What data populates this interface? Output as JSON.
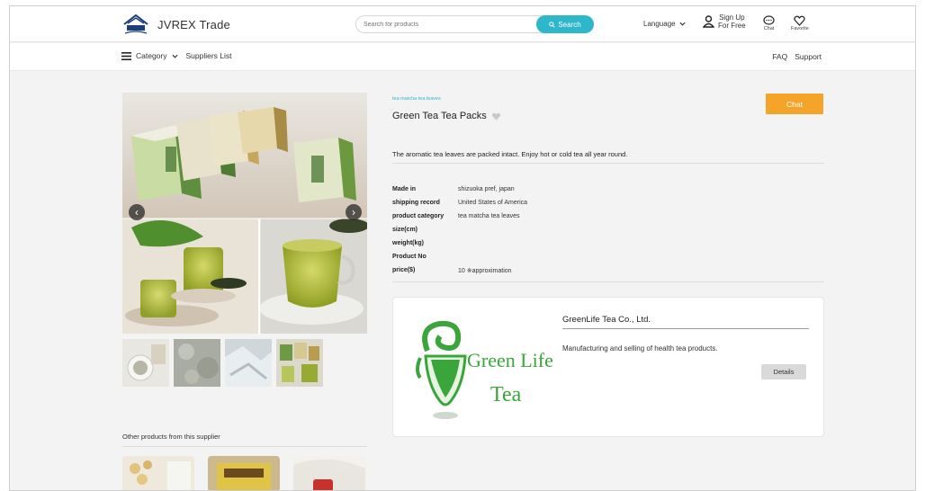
{
  "header": {
    "brand": "JVREX Trade",
    "search_placeholder": "Search for products",
    "search_button": "Search",
    "language": "Language",
    "signup_line1": "Sign Up",
    "signup_line2": "For Free",
    "chat": "Chat",
    "favorite": "Favorite"
  },
  "subnav": {
    "category": "Category",
    "suppliers": "Suppliers List",
    "faq": "FAQ",
    "support": "Support"
  },
  "product": {
    "breadcrumb": "tea matcha tea leaves",
    "title": "Green Tea Tea Packs",
    "chat_button": "Chat",
    "description": "The aromatic tea leaves are packed intact. Enjoy hot or cold tea all year round.",
    "specs": [
      {
        "label": "Made in",
        "value": "shizuoka pref, japan"
      },
      {
        "label": "shipping record",
        "value": "United States of America"
      },
      {
        "label": "product category",
        "value": "tea matcha tea leaves"
      },
      {
        "label": "size(cm)",
        "value": ""
      },
      {
        "label": "weight(kg)",
        "value": ""
      },
      {
        "label": "Product No",
        "value": ""
      },
      {
        "label": "price($)",
        "value": "10 ※approximation"
      }
    ]
  },
  "supplier": {
    "name": "GreenLife Tea Co., Ltd.",
    "description": "Manufacturing and selling of health tea products.",
    "details_button": "Details",
    "logo_text_1": "Green Life",
    "logo_text_2": "Tea"
  },
  "other": {
    "label": "Other products from this supplier"
  },
  "colors": {
    "accent": "#2eb7cb",
    "chat_button": "#f4a529",
    "logo_green": "#3aa53a"
  }
}
